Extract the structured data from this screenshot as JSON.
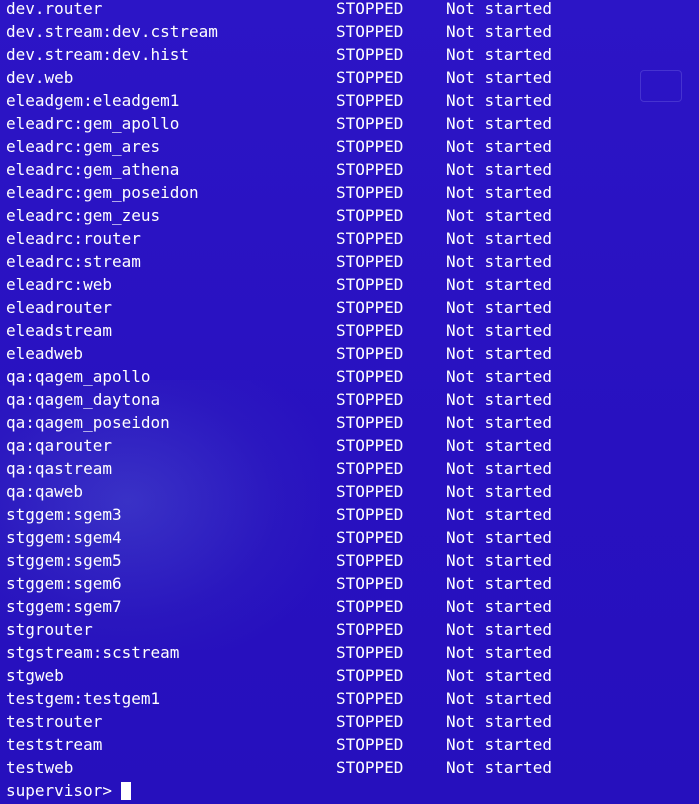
{
  "terminal": {
    "processes": [
      {
        "name": "dev.router",
        "state": "STOPPED",
        "description": "Not started"
      },
      {
        "name": "dev.stream:dev.cstream",
        "state": "STOPPED",
        "description": "Not started"
      },
      {
        "name": "dev.stream:dev.hist",
        "state": "STOPPED",
        "description": "Not started"
      },
      {
        "name": "dev.web",
        "state": "STOPPED",
        "description": "Not started"
      },
      {
        "name": "eleadgem:eleadgem1",
        "state": "STOPPED",
        "description": "Not started"
      },
      {
        "name": "eleadrc:gem_apollo",
        "state": "STOPPED",
        "description": "Not started"
      },
      {
        "name": "eleadrc:gem_ares",
        "state": "STOPPED",
        "description": "Not started"
      },
      {
        "name": "eleadrc:gem_athena",
        "state": "STOPPED",
        "description": "Not started"
      },
      {
        "name": "eleadrc:gem_poseidon",
        "state": "STOPPED",
        "description": "Not started"
      },
      {
        "name": "eleadrc:gem_zeus",
        "state": "STOPPED",
        "description": "Not started"
      },
      {
        "name": "eleadrc:router",
        "state": "STOPPED",
        "description": "Not started"
      },
      {
        "name": "eleadrc:stream",
        "state": "STOPPED",
        "description": "Not started"
      },
      {
        "name": "eleadrc:web",
        "state": "STOPPED",
        "description": "Not started"
      },
      {
        "name": "eleadrouter",
        "state": "STOPPED",
        "description": "Not started"
      },
      {
        "name": "eleadstream",
        "state": "STOPPED",
        "description": "Not started"
      },
      {
        "name": "eleadweb",
        "state": "STOPPED",
        "description": "Not started"
      },
      {
        "name": "qa:qagem_apollo",
        "state": "STOPPED",
        "description": "Not started"
      },
      {
        "name": "qa:qagem_daytona",
        "state": "STOPPED",
        "description": "Not started"
      },
      {
        "name": "qa:qagem_poseidon",
        "state": "STOPPED",
        "description": "Not started"
      },
      {
        "name": "qa:qarouter",
        "state": "STOPPED",
        "description": "Not started"
      },
      {
        "name": "qa:qastream",
        "state": "STOPPED",
        "description": "Not started"
      },
      {
        "name": "qa:qaweb",
        "state": "STOPPED",
        "description": "Not started"
      },
      {
        "name": "stggem:sgem3",
        "state": "STOPPED",
        "description": "Not started"
      },
      {
        "name": "stggem:sgem4",
        "state": "STOPPED",
        "description": "Not started"
      },
      {
        "name": "stggem:sgem5",
        "state": "STOPPED",
        "description": "Not started"
      },
      {
        "name": "stggem:sgem6",
        "state": "STOPPED",
        "description": "Not started"
      },
      {
        "name": "stggem:sgem7",
        "state": "STOPPED",
        "description": "Not started"
      },
      {
        "name": "stgrouter",
        "state": "STOPPED",
        "description": "Not started"
      },
      {
        "name": "stgstream:scstream",
        "state": "STOPPED",
        "description": "Not started"
      },
      {
        "name": "stgweb",
        "state": "STOPPED",
        "description": "Not started"
      },
      {
        "name": "testgem:testgem1",
        "state": "STOPPED",
        "description": "Not started"
      },
      {
        "name": "testrouter",
        "state": "STOPPED",
        "description": "Not started"
      },
      {
        "name": "teststream",
        "state": "STOPPED",
        "description": "Not started"
      },
      {
        "name": "testweb",
        "state": "STOPPED",
        "description": "Not started"
      }
    ],
    "prompt": "supervisor>",
    "input_value": ""
  },
  "colors": {
    "background": "#2a12c4",
    "text": "#ffffff"
  }
}
